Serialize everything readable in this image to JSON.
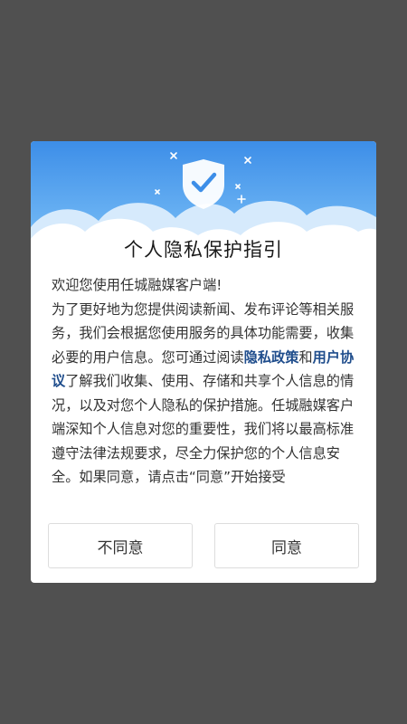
{
  "dialog": {
    "title": "个人隐私保护指引",
    "intro_line1": "欢迎您使用任城融媒客户端!",
    "text_part1": "为了更好地为您提供阅读新闻、发布评论等相关服务，我们会根据您使用服务的具体功能需要，收集必要的用户信息。您可通过阅读",
    "privacy_link": "隐私政策",
    "text_and": "和",
    "agreement_link": "用户协议",
    "text_part2": "了解我们收集、使用、存储和共享个人信息的情况，以及对您个人隐私的保护措施。任城融媒客户端深知个人信息对您的重要性，我们将以最高标准遵守法律法规要求，尽全力保护您的个人信息安全。如果同意，请点击“同意”开始接受",
    "disagree_label": "不同意",
    "agree_label": "同意"
  },
  "colors": {
    "backdrop": "#505050",
    "banner_top": "#3d8ee8",
    "banner_bottom": "#7bc0f7",
    "link": "#1f4d8c",
    "shield": "#ffffff",
    "check": "#3d8ee8"
  },
  "icons": {
    "banner_icon": "shield-check-icon"
  }
}
